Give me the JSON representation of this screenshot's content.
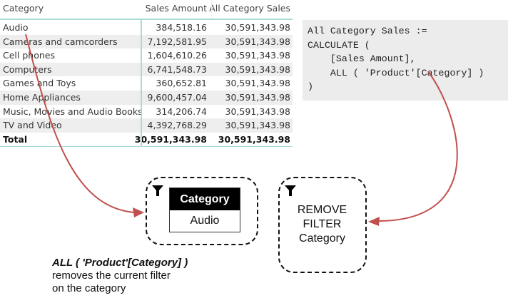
{
  "table": {
    "headers": [
      "Category",
      "Sales Amount",
      "All Category Sales"
    ],
    "rows": [
      [
        "Audio",
        "384,518.16",
        "30,591,343.98"
      ],
      [
        "Cameras and camcorders",
        "7,192,581.95",
        "30,591,343.98"
      ],
      [
        "Cell phones",
        "1,604,610.26",
        "30,591,343.98"
      ],
      [
        "Computers",
        "6,741,548.73",
        "30,591,343.98"
      ],
      [
        "Games and Toys",
        "360,652.81",
        "30,591,343.98"
      ],
      [
        "Home Appliances",
        "9,600,457.04",
        "30,591,343.98"
      ],
      [
        "Music, Movies and Audio Books",
        "314,206.74",
        "30,591,343.98"
      ],
      [
        "TV and Video",
        "4,392,768.29",
        "30,591,343.98"
      ]
    ],
    "total": [
      "Total",
      "30,591,343.98",
      "30,591,343.98"
    ]
  },
  "code": [
    "All Category Sales :=",
    "CALCULATE (",
    "    [Sales Amount],",
    "    ALL ( 'Product'[Category] )",
    ")"
  ],
  "filter_box": {
    "header": "Category",
    "value": "Audio"
  },
  "remove_box": {
    "line1": "REMOVE",
    "line2": "FILTER",
    "line3": "Category"
  },
  "note": {
    "line1": "ALL ( 'Product'[Category] )",
    "line2": "removes the current filter",
    "line3": "on the category"
  },
  "colors": {
    "arrow": "#c0504d",
    "accent": "#a8dcd8"
  }
}
